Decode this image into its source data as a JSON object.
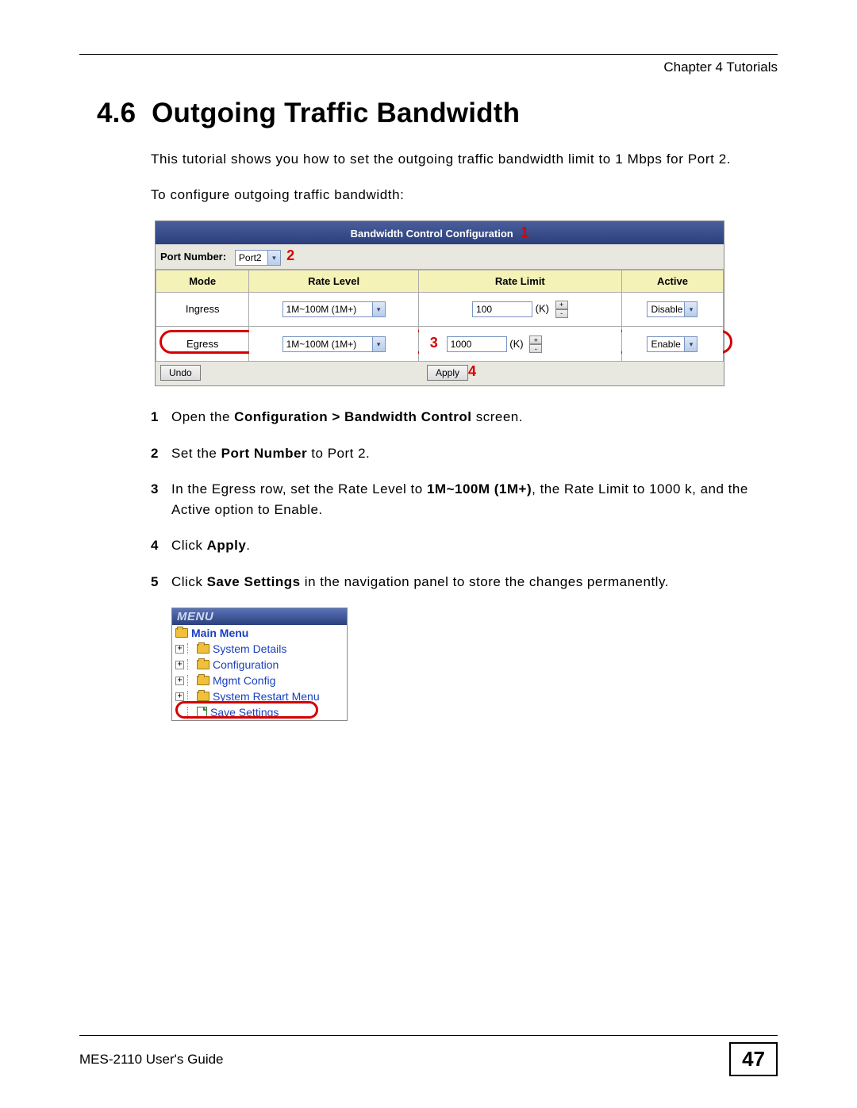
{
  "header": {
    "chapter": "Chapter 4 Tutorials"
  },
  "section": {
    "number": "4.6",
    "title": "Outgoing Traffic Bandwidth"
  },
  "intro1": "This tutorial shows you how to set the outgoing traffic bandwidth limit to 1 Mbps for Port 2.",
  "intro2": "To configure outgoing traffic bandwidth:",
  "panel": {
    "title": "Bandwidth Control Configuration",
    "port_label": "Port Number:",
    "port_value": "Port2",
    "columns": {
      "mode": "Mode",
      "level": "Rate Level",
      "limit": "Rate Limit",
      "active": "Active"
    },
    "rows": [
      {
        "mode": "Ingress",
        "level": "1M~100M (1M+)",
        "limit_value": "100",
        "limit_unit": "(K)",
        "active": "Disable"
      },
      {
        "mode": "Egress",
        "level": "1M~100M (1M+)",
        "limit_value": "1000",
        "limit_unit": "(K)",
        "active": "Enable"
      }
    ],
    "undo": "Undo",
    "apply": "Apply"
  },
  "callouts": {
    "c1": "1",
    "c2": "2",
    "c3": "3",
    "c4": "4"
  },
  "steps": [
    {
      "n": "1",
      "prefix": "Open the ",
      "b": "Configuration > Bandwidth Control",
      "suffix": " screen."
    },
    {
      "n": "2",
      "prefix": "Set the ",
      "b": "Port Number",
      "suffix": " to Port 2."
    },
    {
      "n": "3",
      "prefix": "In the Egress row, set the Rate Level to ",
      "b": "1M~100M (1M+)",
      "suffix": ", the Rate Limit to 1000 k, and the Active option to Enable."
    },
    {
      "n": "4",
      "prefix": "Click ",
      "b": "Apply",
      "suffix": "."
    },
    {
      "n": "5",
      "prefix": "Click ",
      "b": "Save Settings",
      "suffix": " in the navigation panel to store the changes permanently."
    }
  ],
  "menu": {
    "heading": "MENU",
    "main": "Main Menu",
    "items": [
      "System Details",
      "Configuration",
      "Mgmt Config",
      "System Restart Menu",
      "Save Settings"
    ]
  },
  "footer": {
    "guide": "MES-2110 User's Guide",
    "page": "47"
  }
}
